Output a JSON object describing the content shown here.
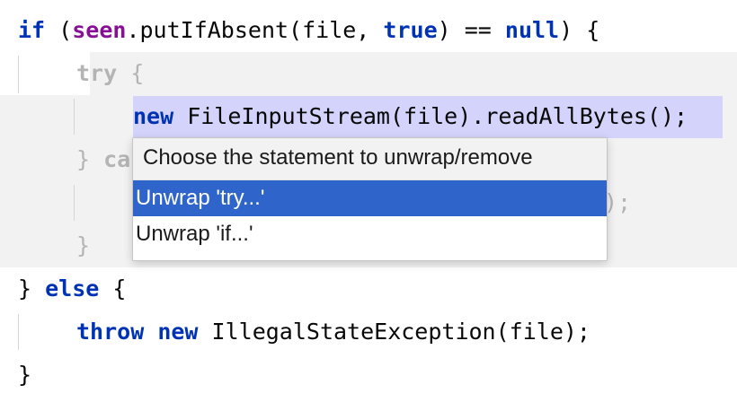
{
  "code": {
    "line1": {
      "kw_if": "if",
      "paren_open": " (",
      "field": "seen",
      "call": ".putIfAbsent(file, ",
      "kw_true": "true",
      "compare": ") == ",
      "kw_null": "null",
      "tail": ") {"
    },
    "line2": {
      "kw_try": "try",
      "tail": " {"
    },
    "line3": {
      "kw_new": "new",
      "tail": " FileInputStream(file).readAllBytes();"
    },
    "line4": {
      "brace": "} ",
      "partial": "ca"
    },
    "line5": {
      "partial_tail": ");"
    },
    "line6": {
      "brace": "}"
    },
    "line7": {
      "brace": "} ",
      "kw_else": "else",
      "tail": " {"
    },
    "line8": {
      "kw_throw": "throw",
      "space": " ",
      "kw_new": "new",
      "tail": " IllegalStateException(file);"
    },
    "line9": {
      "brace": "}"
    }
  },
  "popup": {
    "title": "Choose the statement to unwrap/remove",
    "items": [
      {
        "label": "Unwrap 'try...'",
        "selected": true
      },
      {
        "label": "Unwrap 'if...'",
        "selected": false
      }
    ]
  },
  "colors": {
    "keyword": "#0033b3",
    "field": "#871094",
    "selection": "#d3d3fb",
    "highlight_block": "#f2f2f2",
    "popup_selected": "#2f65ca"
  }
}
